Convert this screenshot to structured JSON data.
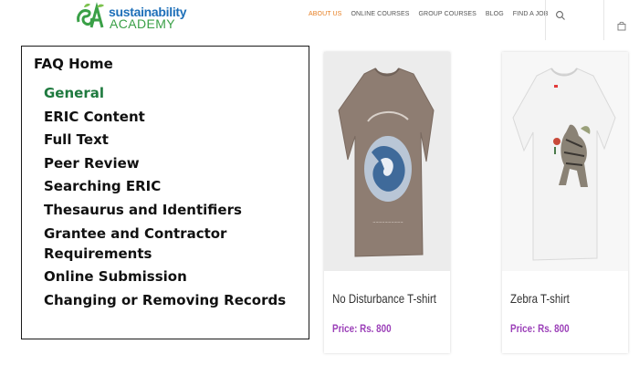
{
  "header": {
    "logo": {
      "line1": "sustainability",
      "line2": "ACADEMY"
    },
    "nav": [
      {
        "label": "ABOUT US",
        "active": true
      },
      {
        "label": "ONLINE COURSES",
        "active": false
      },
      {
        "label": "GROUP COURSES",
        "active": false
      },
      {
        "label": "BLOG",
        "active": false
      },
      {
        "label": "FIND A JOB",
        "active": false
      }
    ],
    "icons": {
      "search": "search-icon",
      "cart": "shopping-bag-icon"
    },
    "colors": {
      "nav_active": "#e67e22",
      "logo_blue": "#1d6fb8",
      "logo_green": "#3aa047"
    }
  },
  "faq": {
    "title": "FAQ Home",
    "items": [
      {
        "label": "General",
        "current": true
      },
      {
        "label": "ERIC Content"
      },
      {
        "label": "Full Text"
      },
      {
        "label": "Peer Review"
      },
      {
        "label": "Searching ERIC"
      },
      {
        "label": "Thesaurus and Identifiers"
      },
      {
        "label": "Grantee and Contractor Requirements"
      },
      {
        "label": "Online Submission"
      },
      {
        "label": "Changing or Removing Records"
      }
    ],
    "colors": {
      "current": "#1f7a3f"
    }
  },
  "products": [
    {
      "name": "No Disturbance T-shirt",
      "price": "Price: Rs. 800",
      "image": "brown-graphic-tshirt"
    },
    {
      "name": "Zebra T-shirt",
      "price": "Price: Rs. 800",
      "image": "white-zebra-tshirt"
    }
  ],
  "colors": {
    "price": "#9b3fb8"
  }
}
